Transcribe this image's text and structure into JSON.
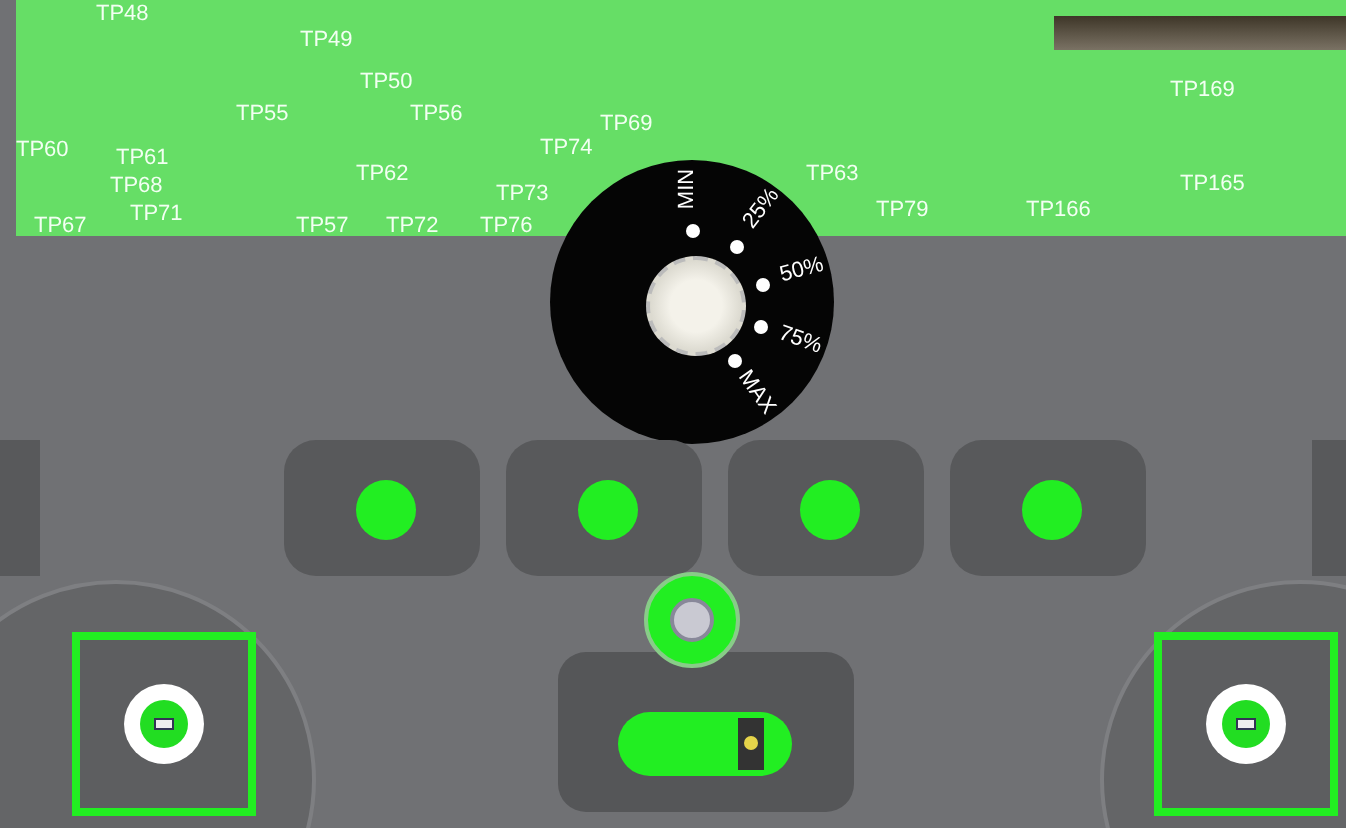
{
  "board": {
    "silkscreen_labels": [
      "TP48",
      "TP49",
      "TP50",
      "TP55",
      "TP56",
      "TP69",
      "TP60",
      "TP61",
      "TP74",
      "TP62",
      "TP68",
      "TP73",
      "TP71",
      "TP67",
      "TP57",
      "TP72",
      "TP76",
      "TP63",
      "TP79",
      "TP166",
      "TP169",
      "TP165"
    ]
  },
  "dial": {
    "labels": [
      "MIN",
      "25%",
      "50%",
      "75%",
      "MAX"
    ]
  },
  "indicators": [
    {
      "on": true
    },
    {
      "on": true
    },
    {
      "on": true
    },
    {
      "on": true
    }
  ],
  "side_buttons": [
    {
      "selected": true
    },
    {
      "selected": true
    }
  ],
  "switch": {
    "on": true
  }
}
